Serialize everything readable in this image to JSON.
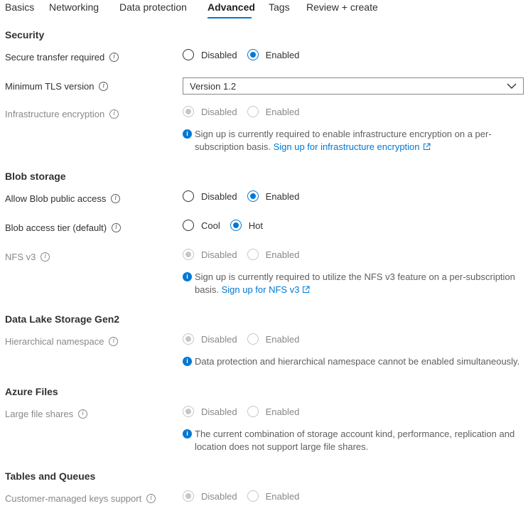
{
  "tabs": [
    "Basics",
    "Networking",
    "Data protection",
    "Advanced",
    "Tags",
    "Review + create"
  ],
  "active_tab": "Advanced",
  "colors": {
    "accent": "#0078d4",
    "disabled": "#c8c6c4",
    "text": "#323130",
    "muted": "#8a8886"
  },
  "security": {
    "title": "Security",
    "secure_transfer": {
      "label": "Secure transfer required",
      "opt1": "Disabled",
      "opt2": "Enabled",
      "selected": "Enabled"
    },
    "min_tls": {
      "label": "Minimum TLS version",
      "value": "Version 1.2"
    },
    "infra_encryption": {
      "label": "Infrastructure encryption",
      "opt1": "Disabled",
      "opt2": "Enabled",
      "selected": "Disabled",
      "disabled": true
    },
    "infra_info": {
      "text": "Sign up is currently required to enable infrastructure encryption on a per-subscription basis.",
      "link": "Sign up for infrastructure encryption"
    }
  },
  "blob": {
    "title": "Blob storage",
    "public_access": {
      "label": "Allow Blob public access",
      "opt1": "Disabled",
      "opt2": "Enabled",
      "selected": "Enabled"
    },
    "access_tier": {
      "label": "Blob access tier (default)",
      "opt1": "Cool",
      "opt2": "Hot",
      "selected": "Hot"
    },
    "nfs": {
      "label": "NFS v3",
      "opt1": "Disabled",
      "opt2": "Enabled",
      "selected": "Disabled",
      "disabled": true
    },
    "nfs_info": {
      "text": "Sign up is currently required to utilize the NFS v3 feature on a per-subscription basis.",
      "link": "Sign up for NFS v3"
    }
  },
  "datalake": {
    "title": "Data Lake Storage Gen2",
    "hns": {
      "label": "Hierarchical namespace",
      "opt1": "Disabled",
      "opt2": "Enabled",
      "selected": "Disabled",
      "disabled": true
    },
    "hns_info": {
      "text": "Data protection and hierarchical namespace cannot be enabled simultaneously."
    }
  },
  "files": {
    "title": "Azure Files",
    "large_shares": {
      "label": "Large file shares",
      "opt1": "Disabled",
      "opt2": "Enabled",
      "selected": "Disabled",
      "disabled": true
    },
    "large_info": {
      "text": "The current combination of storage account kind, performance, replication and location does not support large file shares."
    }
  },
  "tables": {
    "title": "Tables and Queues",
    "cmk": {
      "label": "Customer-managed keys support",
      "opt1": "Disabled",
      "opt2": "Enabled",
      "selected": "Disabled",
      "disabled": true
    }
  }
}
